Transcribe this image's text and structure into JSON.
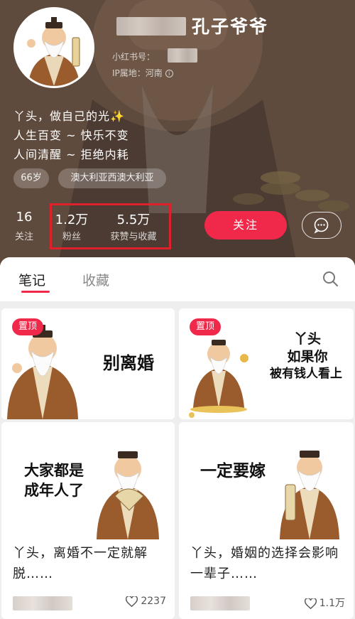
{
  "profile": {
    "nickname": "孔子爷爷",
    "id_label": "小红书号：",
    "ip_label": "IP属地：河南",
    "info_icon": "ⓘ",
    "bio": [
      "丫头，做自己的光✨",
      "人生百变 ~ 快乐不变",
      "人间清醒 ~ 拒绝内耗"
    ],
    "tags": [
      "66岁",
      "澳大利亚西澳大利亚"
    ]
  },
  "stats": [
    {
      "value": "16",
      "label": "关注"
    },
    {
      "value": "1.2万",
      "label": "粉丝"
    },
    {
      "value": "5.5万",
      "label": "获赞与收藏"
    }
  ],
  "actions": {
    "follow_label": "关注",
    "chat_icon": "chat-bubble-icon"
  },
  "tabs": {
    "active": "笔记",
    "inactive": "收藏",
    "search_icon": "search-icon"
  },
  "notes": [
    {
      "pin": "置顶",
      "image_text": [
        "别离婚"
      ]
    },
    {
      "pin": "置顶",
      "image_text": [
        "丫头",
        "如果你",
        "被有钱人看上"
      ]
    },
    {
      "image_text": [
        "大家都是",
        "成年人了"
      ],
      "title": "丫头，离婚不一定就解脱……",
      "likes": "2237"
    },
    {
      "image_text": [
        "一定要嫁"
      ],
      "title": "丫头，婚姻的选择会影响一辈子……",
      "likes": "1.1万"
    }
  ],
  "colors": {
    "accent": "#f0294a",
    "highlight_box": "#e0202a"
  }
}
